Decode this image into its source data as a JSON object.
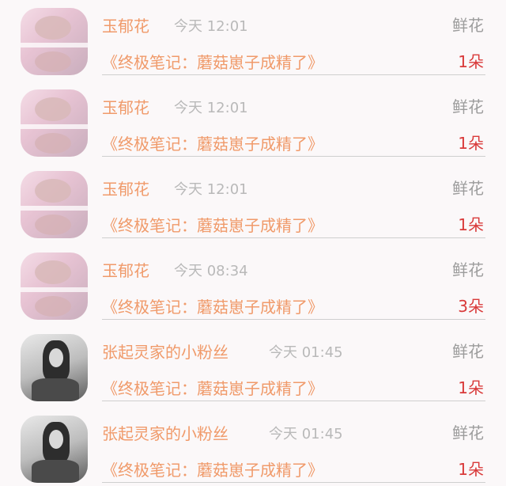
{
  "gifts": [
    {
      "user": "玉郁花",
      "time": "今天 12:01",
      "gift_type": "鲜花",
      "book": "《终极笔记：蘑菇崽子成精了》",
      "count": "1朵",
      "avatar": "pink-avatar"
    },
    {
      "user": "玉郁花",
      "time": "今天 12:01",
      "gift_type": "鲜花",
      "book": "《终极笔记：蘑菇崽子成精了》",
      "count": "1朵",
      "avatar": "pink-avatar"
    },
    {
      "user": "玉郁花",
      "time": "今天 12:01",
      "gift_type": "鲜花",
      "book": "《终极笔记：蘑菇崽子成精了》",
      "count": "1朵",
      "avatar": "pink-avatar"
    },
    {
      "user": "玉郁花",
      "time": "今天 08:34",
      "gift_type": "鲜花",
      "book": "《终极笔记：蘑菇崽子成精了》",
      "count": "3朵",
      "avatar": "pink-avatar"
    },
    {
      "user": "张起灵家的小粉丝",
      "time": "今天 01:45",
      "gift_type": "鲜花",
      "book": "《终极笔记：蘑菇崽子成精了》",
      "count": "1朵",
      "avatar": "bw-avatar"
    },
    {
      "user": "张起灵家的小粉丝",
      "time": "今天 01:45",
      "gift_type": "鲜花",
      "book": "《终极笔记：蘑菇崽子成精了》",
      "count": "1朵",
      "avatar": "bw-avatar"
    }
  ],
  "colors": {
    "name": "#f09a6a",
    "time": "#b9b9b9",
    "gift_type": "#9c9c9c",
    "count": "#d93a3a",
    "background": "#fbf8f9"
  }
}
